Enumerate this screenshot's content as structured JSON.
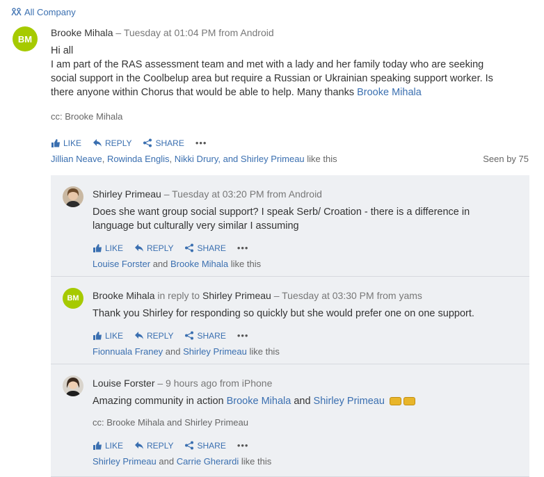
{
  "group": {
    "label": "All Company"
  },
  "post": {
    "initials": "BM",
    "author": "Brooke Mihala",
    "meta": "– Tuesday at 01:04 PM from Android",
    "line1": "Hi all",
    "line2": "I am part of the RAS assessment team and met with a lady and her family today who are seeking",
    "line3": "social support in the Coolbelup area but require a Russian or Ukrainian speaking support worker. Is",
    "line4_text": "there anyone within Chorus that would be able to help. Many thanks ",
    "line4_link": "Brooke Mihala",
    "cc": "cc: Brooke Mihala",
    "likers": [
      "Jillian Neave",
      "Rowinda Englis",
      "Nikki Drury"
    ],
    "likers_last": "Shirley Primeau",
    "sep1": ", ",
    "sep2": ", ",
    "and": ", and ",
    "like_suffix": " like this",
    "seen": "Seen by 75"
  },
  "actions": {
    "like": "LIKE",
    "reply": "REPLY",
    "share": "SHARE",
    "more": "•••"
  },
  "replies": [
    {
      "author": "Shirley Primeau",
      "meta": "– Tuesday at 03:20 PM from Android",
      "line1": "Does she want group social support? I speak Serb/ Croation - there is a difference in",
      "line2": "language but culturally very similar I assuming",
      "liker1": "Louise Forster",
      "and": " and ",
      "liker2": "Brooke Mihala",
      "suffix": " like this"
    },
    {
      "initials": "BM",
      "author": "Brooke Mihala",
      "inreply": " in reply to ",
      "inreply_name": "Shirley Primeau",
      "meta": " – Tuesday at 03:30 PM from yams",
      "line1": "Thank you Shirley for responding so quickly but she would prefer one on one support.",
      "liker1": "Fionnuala Franey",
      "and": " and ",
      "liker2": "Shirley Primeau",
      "suffix": " like this"
    },
    {
      "author": "Louise Forster",
      "meta": "– 9 hours ago from iPhone",
      "line1_text": "Amazing community in action ",
      "line1_link1": "Brooke Mihala",
      "line1_and": " and ",
      "line1_link2": "Shirley Primeau",
      "cc": "cc: Brooke Mihala and Shirley Primeau",
      "liker1": "Shirley Primeau",
      "and": " and ",
      "liker2": "Carrie Gherardi",
      "suffix": " like this"
    }
  ],
  "colors": {
    "accent": "#3a6fb0",
    "avatar": "#a6ca00",
    "panel": "#eef0f3"
  }
}
